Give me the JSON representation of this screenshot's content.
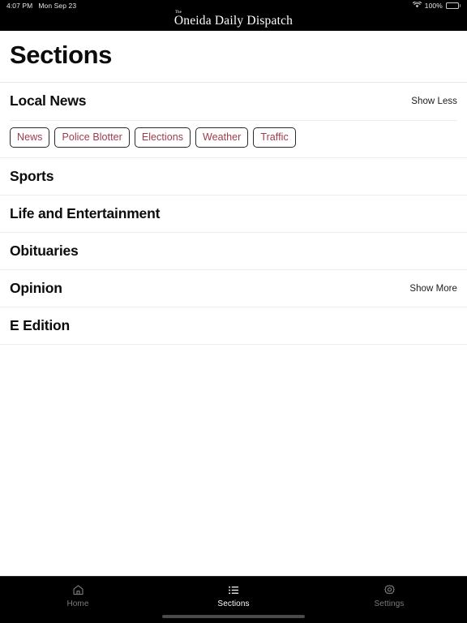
{
  "status_bar": {
    "time": "4:07 PM",
    "date": "Mon Sep 23",
    "battery_percent": "100%",
    "wifi_icon": "wifi-icon",
    "battery_icon": "battery-icon"
  },
  "masthead": {
    "prefix": "The",
    "title": "Oneida Daily Dispatch"
  },
  "page": {
    "title": "Sections"
  },
  "sections": [
    {
      "label": "Local News",
      "toggle": "Show Less",
      "expanded": true,
      "chips": [
        "News",
        "Police Blotter",
        "Elections",
        "Weather",
        "Traffic"
      ]
    },
    {
      "label": "Sports",
      "toggle": "",
      "expanded": false,
      "chips": []
    },
    {
      "label": "Life and Entertainment",
      "toggle": "",
      "expanded": false,
      "chips": []
    },
    {
      "label": "Obituaries",
      "toggle": "",
      "expanded": false,
      "chips": []
    },
    {
      "label": "Opinion",
      "toggle": "Show More",
      "expanded": false,
      "chips": []
    },
    {
      "label": "E Edition",
      "toggle": "",
      "expanded": false,
      "chips": []
    }
  ],
  "tab_bar": {
    "items": [
      {
        "label": "Home",
        "icon": "home-icon",
        "active": false
      },
      {
        "label": "Sections",
        "icon": "list-icon",
        "active": true
      },
      {
        "label": "Settings",
        "icon": "gear-icon",
        "active": false
      }
    ]
  },
  "colors": {
    "chip_text": "#9d3b4c",
    "chip_border": "#2a2a2a",
    "bar_background": "#000000",
    "rule": "#ececec",
    "tab_active": "#ffffff",
    "tab_inactive": "#7d7d7d"
  }
}
